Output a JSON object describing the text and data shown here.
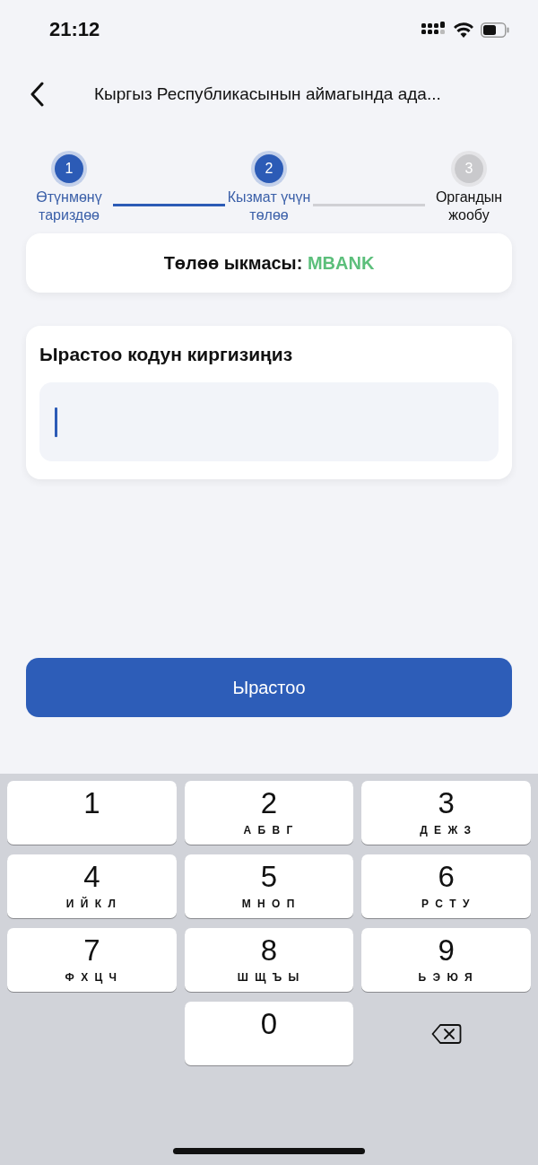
{
  "status_bar": {
    "time": "21:12"
  },
  "header": {
    "title": "Кыргыз Республикасынын аймагында ада..."
  },
  "steps": [
    {
      "number": "1",
      "label": "Өтүнмөнү тариздөө",
      "active": true
    },
    {
      "number": "2",
      "label": "Кызмат үчүн төлөө",
      "active": true
    },
    {
      "number": "3",
      "label": "Органдын жообу",
      "active": false
    }
  ],
  "payment": {
    "label": "Төлөө ыкмасы:",
    "value": "MBANK"
  },
  "code": {
    "label": "Ырастоо кодун киргизиңиз"
  },
  "confirm_button": "Ырастоо",
  "keypad": [
    {
      "kind": "key",
      "digit": "1"
    },
    {
      "kind": "key",
      "digit": "2",
      "letters": "А Б В Г"
    },
    {
      "kind": "key",
      "digit": "3",
      "letters": "Д Е Ж З"
    },
    {
      "kind": "key",
      "digit": "4",
      "letters": "И Й К Л"
    },
    {
      "kind": "key",
      "digit": "5",
      "letters": "М Н О П"
    },
    {
      "kind": "key",
      "digit": "6",
      "letters": "Р С Т У"
    },
    {
      "kind": "key",
      "digit": "7",
      "letters": "Ф Х Ц Ч"
    },
    {
      "kind": "key",
      "digit": "8",
      "letters": "Ш Щ Ъ Ы"
    },
    {
      "kind": "key",
      "digit": "9",
      "letters": "Ь Э Ю Я"
    },
    {
      "kind": "blank"
    },
    {
      "kind": "key",
      "digit": "0"
    },
    {
      "kind": "delete"
    }
  ]
}
